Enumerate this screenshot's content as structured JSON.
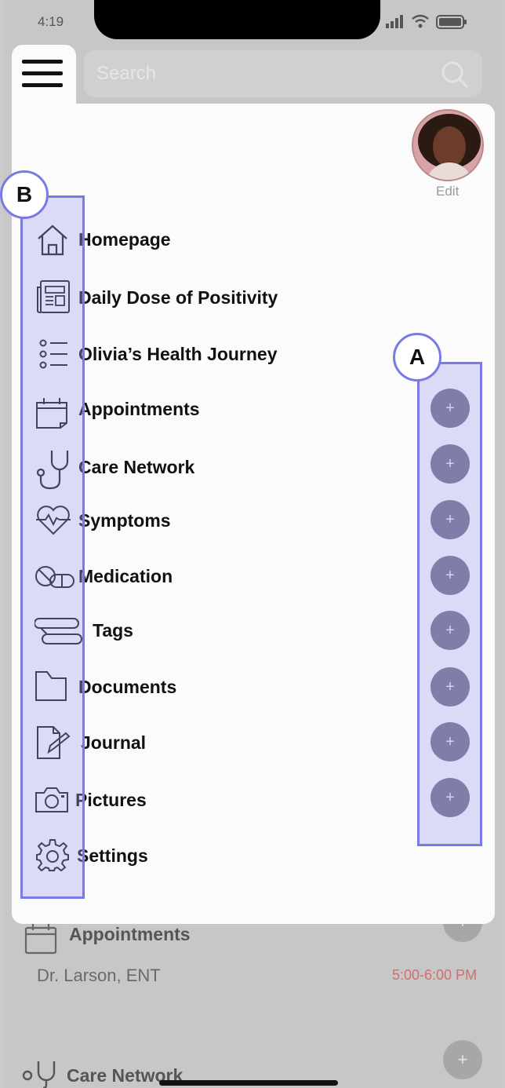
{
  "status_bar": {
    "time": "4:19"
  },
  "search": {
    "placeholder": "Search"
  },
  "profile": {
    "edit_label": "Edit"
  },
  "menu": {
    "items": [
      {
        "label": "Homepage",
        "icon": "home-icon"
      },
      {
        "label": "Daily Dose of Positivity",
        "icon": "newspaper-icon"
      },
      {
        "label": "Olivia’s Health Journey",
        "icon": "list-icon"
      },
      {
        "label": "Appointments",
        "icon": "calendar-icon"
      },
      {
        "label": "Care Network",
        "icon": "stethoscope-icon"
      },
      {
        "label": "Symptoms",
        "icon": "heartbeat-icon"
      },
      {
        "label": "Medication",
        "icon": "pills-icon"
      },
      {
        "label": "Tags",
        "icon": "tag-icon"
      },
      {
        "label": "Documents",
        "icon": "folder-icon"
      },
      {
        "label": "Journal",
        "icon": "journal-edit-icon"
      },
      {
        "label": "Pictures",
        "icon": "camera-icon"
      },
      {
        "label": "Settings",
        "icon": "gear-icon"
      }
    ],
    "add_button_label": "+"
  },
  "annotations": {
    "badge_a": "A",
    "badge_b": "B"
  },
  "background": {
    "appointments_label": "Appointments",
    "appointment_doctor": "Dr. Larson, ENT",
    "appointment_time": "5:00-6:00 PM",
    "care_network_label": "Care Network",
    "plus": "+"
  },
  "colors": {
    "add_button": "#6d6c86",
    "highlight": "#7a7ae6",
    "appointment_time": "#d26e6e"
  }
}
